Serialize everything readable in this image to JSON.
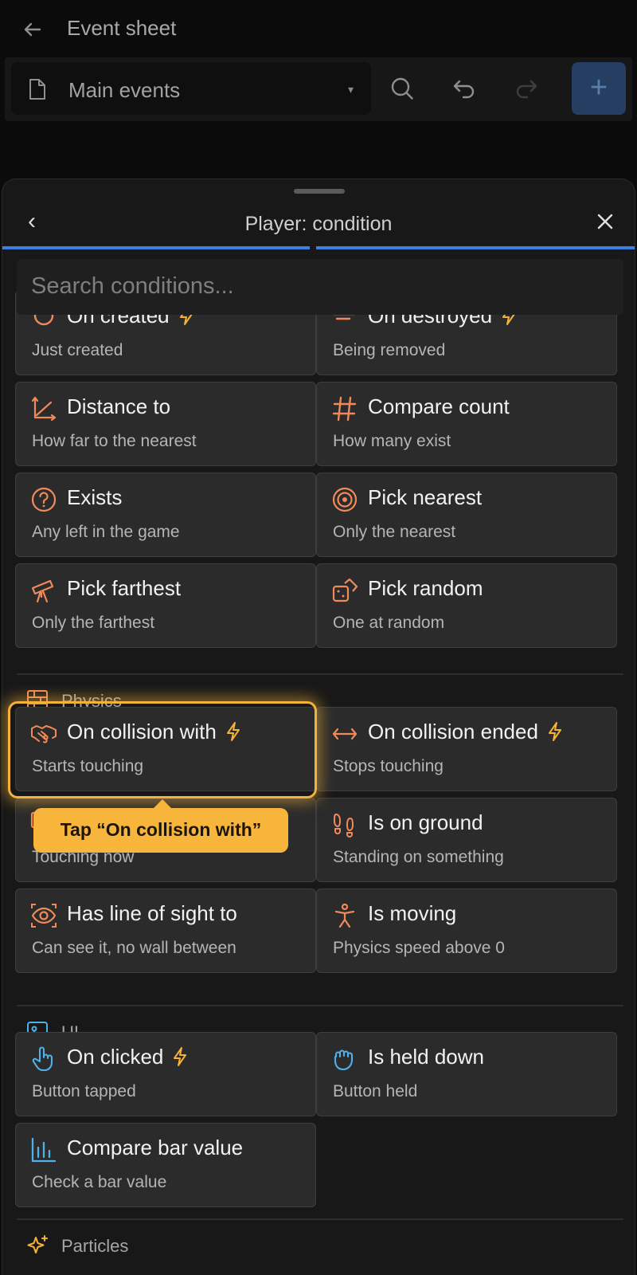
{
  "topbar": {
    "title": "Event sheet"
  },
  "toolbar": {
    "sheet_name": "Main events",
    "caret": "▾",
    "add": "+"
  },
  "sheet": {
    "back": "‹",
    "title": "Player: condition"
  },
  "search": {
    "placeholder": "Search conditions..."
  },
  "cards": [
    {
      "title": "On created",
      "subtitle": "Just created",
      "trigger": true,
      "icon": "circle-icon"
    },
    {
      "title": "On destroyed",
      "subtitle": "Being removed",
      "trigger": true,
      "icon": "wind-icon"
    },
    {
      "title": "Distance to",
      "subtitle": "How far to the nearest",
      "trigger": false,
      "icon": "distance-icon"
    },
    {
      "title": "Compare count",
      "subtitle": "How many exist",
      "trigger": false,
      "icon": "hash-icon"
    },
    {
      "title": "Exists",
      "subtitle": "Any left in the game",
      "trigger": false,
      "icon": "question-icon"
    },
    {
      "title": "Pick nearest",
      "subtitle": "Only the nearest",
      "trigger": false,
      "icon": "target-icon"
    },
    {
      "title": "Pick farthest",
      "subtitle": "Only the farthest",
      "trigger": false,
      "icon": "telescope-icon"
    },
    {
      "title": "Pick random",
      "subtitle": "One at random",
      "trigger": false,
      "icon": "dice-icon"
    }
  ],
  "physics": {
    "label": "Physics",
    "cards": [
      {
        "title": "On collision with",
        "subtitle": "Starts touching",
        "trigger": true,
        "icon": "handshake-icon"
      },
      {
        "title": "On collision ended",
        "subtitle": "Stops touching",
        "trigger": true,
        "icon": "arrows-horizontal-icon"
      },
      {
        "title": "",
        "subtitle": "Touching now",
        "trigger": false,
        "icon": "overlap-icon"
      },
      {
        "title": "Is on ground",
        "subtitle": "Standing on something",
        "trigger": false,
        "icon": "footprints-icon"
      },
      {
        "title": "Has line of sight to",
        "subtitle": "Can see it, no wall between",
        "trigger": false,
        "icon": "eye-icon"
      },
      {
        "title": "Is moving",
        "subtitle": "Physics speed above 0",
        "trigger": false,
        "icon": "person-icon"
      }
    ]
  },
  "ui": {
    "label": "UI",
    "cards": [
      {
        "title": "On clicked",
        "subtitle": "Button tapped",
        "trigger": true,
        "icon": "pointer-icon"
      },
      {
        "title": "Is held down",
        "subtitle": "Button held",
        "trigger": false,
        "icon": "grab-icon"
      },
      {
        "title": "Compare bar value",
        "subtitle": "Check a bar value",
        "trigger": false,
        "icon": "bar-chart-icon"
      }
    ]
  },
  "particles": {
    "label": "Particles"
  },
  "tooltip": {
    "text": "Tap “On collision with”"
  },
  "colors": {
    "accent_orange": "#f08a5a",
    "bolt_yellow": "#f5b236",
    "ui_blue": "#4fb0e8",
    "highlight": "#f4b23a"
  }
}
